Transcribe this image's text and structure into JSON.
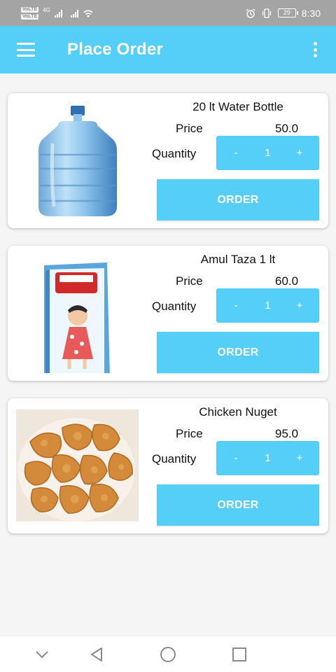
{
  "status_bar": {
    "net_top": "VoLTE",
    "net_bottom": "VoLTE",
    "net_gen": "4G",
    "battery": "29",
    "time": "8:30",
    "icons": [
      "signal-icon",
      "wifi-icon",
      "alarm-icon",
      "vibrate-icon",
      "battery-icon"
    ]
  },
  "app_bar": {
    "title": "Place Order",
    "menu_icon": "hamburger-menu-icon",
    "more_icon": "more-vert-icon"
  },
  "labels": {
    "price": "Price",
    "quantity": "Quantity",
    "minus": "-",
    "plus": "+",
    "order": "ORDER"
  },
  "products": [
    {
      "name": "20 lt Water Bottle",
      "price": "50.0",
      "quantity": "1",
      "image": "water-bottle-image"
    },
    {
      "name": "Amul Taza 1 lt",
      "price": "60.0",
      "quantity": "1",
      "image": "milk-carton-image"
    },
    {
      "name": "Chicken Nuget",
      "price": "95.0",
      "quantity": "1",
      "image": "chicken-nuggets-image"
    }
  ],
  "nav_bar": {
    "icons": [
      "collapse-down-icon",
      "back-icon",
      "home-icon",
      "recents-icon"
    ]
  },
  "colors": {
    "accent": "#55cff8",
    "status_bar": "#a4a4a4",
    "background": "#f5f5f5"
  }
}
